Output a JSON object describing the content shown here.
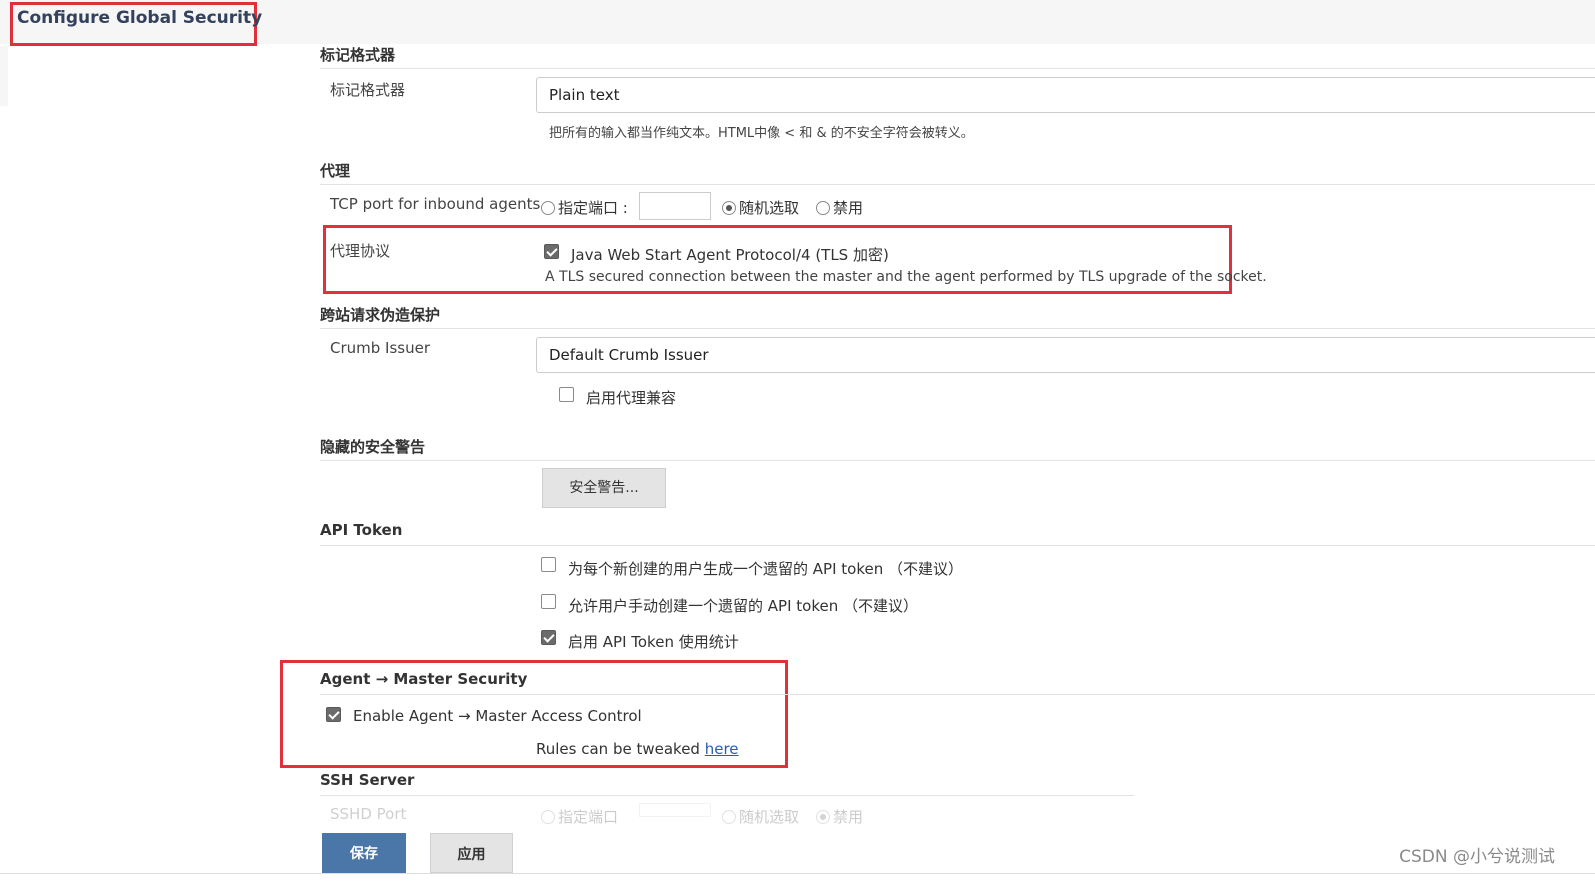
{
  "header": {
    "title": "Configure Global Security"
  },
  "markup": {
    "section": "标记格式器",
    "label": "标记格式器",
    "value": "Plain text",
    "help": "把所有的输入都当作纯文本。HTML中像 < 和 & 的不安全字符会被转义。"
  },
  "agents": {
    "section": "代理",
    "tcp_label": "TCP port for inbound agents",
    "opt_fixed": "指定端口 :",
    "opt_random": "随机选取",
    "opt_disable": "禁用",
    "selected": "随机选取",
    "protocol_label": "代理协议",
    "protocol_name": "Java Web Start Agent Protocol/4 (TLS 加密)",
    "protocol_checked": true,
    "protocol_desc": "A TLS secured connection between the master and the agent performed by TLS upgrade of the socket."
  },
  "csrf": {
    "section": "跨站请求伪造保护",
    "label": "Crumb Issuer",
    "value": "Default Crumb Issuer",
    "proxy_compat": "启用代理兼容",
    "proxy_compat_checked": false
  },
  "hidden_warnings": {
    "section": "隐藏的安全警告",
    "button": "安全警告..."
  },
  "api_token": {
    "section": "API Token",
    "options": [
      {
        "label": "为每个新创建的用户生成一个遗留的 API token （不建议）",
        "checked": false
      },
      {
        "label": "允许用户手动创建一个遗留的 API token （不建议）",
        "checked": false
      },
      {
        "label": "启用 API Token 使用统计",
        "checked": true
      }
    ]
  },
  "agent_master": {
    "section": "Agent → Master Security",
    "enable_label": "Enable Agent → Master Access Control",
    "enable_checked": true,
    "rules_text": "Rules can be tweaked ",
    "rules_link": "here"
  },
  "ssh": {
    "section": "SSH Server",
    "port_label": "SSHD Port",
    "opt_fixed": "指定端口",
    "opt_random": "随机选取",
    "opt_disable": "禁用"
  },
  "actions": {
    "save": "保存",
    "apply": "应用"
  },
  "watermark": "CSDN @小兮说测试",
  "colors": {
    "highlight": "#e0313a",
    "primary_button": "#4a77a8",
    "link": "#2a5db0"
  }
}
